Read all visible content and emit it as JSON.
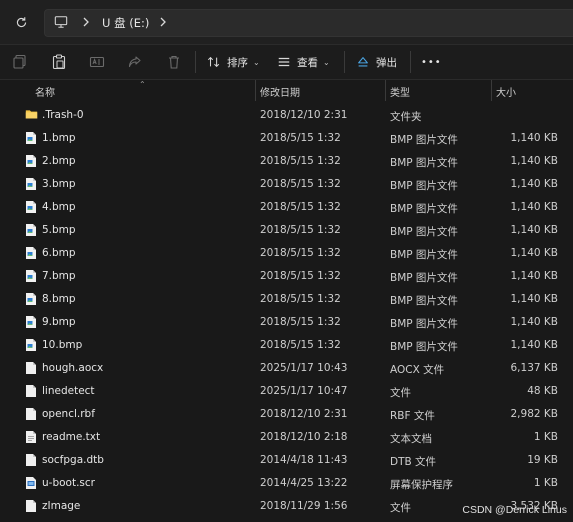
{
  "address": {
    "crumb": "U 盘 (E:)"
  },
  "toolbar": {
    "sort_label": "排序",
    "view_label": "查看",
    "eject_label": "弹出",
    "more_label": "•••"
  },
  "columns": {
    "name": "名称",
    "date": "修改日期",
    "type": "类型",
    "size": "大小"
  },
  "files": [
    {
      "name": ".Trash-0",
      "date": "2018/12/10 2:31",
      "type": "文件夹",
      "size": "",
      "icon": "folder-icon"
    },
    {
      "name": "1.bmp",
      "date": "2018/5/15 1:32",
      "type": "BMP 图片文件",
      "size": "1,140 KB",
      "icon": "image-file-icon"
    },
    {
      "name": "2.bmp",
      "date": "2018/5/15 1:32",
      "type": "BMP 图片文件",
      "size": "1,140 KB",
      "icon": "image-file-icon"
    },
    {
      "name": "3.bmp",
      "date": "2018/5/15 1:32",
      "type": "BMP 图片文件",
      "size": "1,140 KB",
      "icon": "image-file-icon"
    },
    {
      "name": "4.bmp",
      "date": "2018/5/15 1:32",
      "type": "BMP 图片文件",
      "size": "1,140 KB",
      "icon": "image-file-icon"
    },
    {
      "name": "5.bmp",
      "date": "2018/5/15 1:32",
      "type": "BMP 图片文件",
      "size": "1,140 KB",
      "icon": "image-file-icon"
    },
    {
      "name": "6.bmp",
      "date": "2018/5/15 1:32",
      "type": "BMP 图片文件",
      "size": "1,140 KB",
      "icon": "image-file-icon"
    },
    {
      "name": "7.bmp",
      "date": "2018/5/15 1:32",
      "type": "BMP 图片文件",
      "size": "1,140 KB",
      "icon": "image-file-icon"
    },
    {
      "name": "8.bmp",
      "date": "2018/5/15 1:32",
      "type": "BMP 图片文件",
      "size": "1,140 KB",
      "icon": "image-file-icon"
    },
    {
      "name": "9.bmp",
      "date": "2018/5/15 1:32",
      "type": "BMP 图片文件",
      "size": "1,140 KB",
      "icon": "image-file-icon"
    },
    {
      "name": "10.bmp",
      "date": "2018/5/15 1:32",
      "type": "BMP 图片文件",
      "size": "1,140 KB",
      "icon": "image-file-icon"
    },
    {
      "name": "hough.aocx",
      "date": "2025/1/17 10:43",
      "type": "AOCX 文件",
      "size": "6,137 KB",
      "icon": "generic-file-icon"
    },
    {
      "name": "linedetect",
      "date": "2025/1/17 10:47",
      "type": "文件",
      "size": "48 KB",
      "icon": "generic-file-icon"
    },
    {
      "name": "opencl.rbf",
      "date": "2018/12/10 2:31",
      "type": "RBF 文件",
      "size": "2,982 KB",
      "icon": "generic-file-icon"
    },
    {
      "name": "readme.txt",
      "date": "2018/12/10 2:18",
      "type": "文本文档",
      "size": "1 KB",
      "icon": "text-file-icon"
    },
    {
      "name": "socfpga.dtb",
      "date": "2014/4/18 11:43",
      "type": "DTB 文件",
      "size": "19 KB",
      "icon": "generic-file-icon"
    },
    {
      "name": "u-boot.scr",
      "date": "2014/4/25 13:22",
      "type": "屏幕保护程序",
      "size": "1 KB",
      "icon": "screensaver-file-icon"
    },
    {
      "name": "zImage",
      "date": "2018/11/29 1:56",
      "type": "文件",
      "size": "3,532 KB",
      "icon": "generic-file-icon"
    }
  ],
  "watermark": "CSDN @Derrick Linus"
}
